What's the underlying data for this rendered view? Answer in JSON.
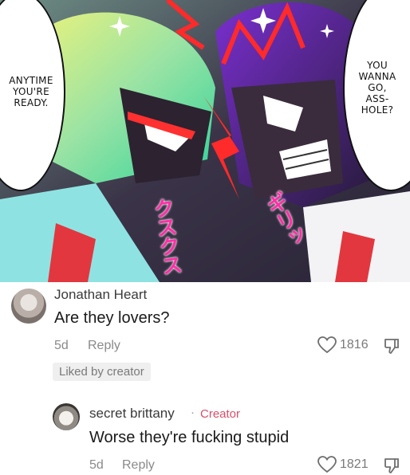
{
  "panel": {
    "bubble_left": "ANYTIME\nYOU'RE\nREADY.",
    "bubble_right": "YOU\nWANNA\nGO,\nASS-\nHOLE?",
    "sfx_left": "クスクス",
    "sfx_right": "ギリッ"
  },
  "comments": [
    {
      "author": "Jonathan Heart",
      "text": "Are they lovers?",
      "time": "5d",
      "reply_label": "Reply",
      "likes": "1816",
      "liked_by": "Liked by creator"
    },
    {
      "author": "secret brittany",
      "separator": "·",
      "badge": "Creator",
      "text": "Worse they're fucking stupid",
      "time": "5d",
      "reply_label": "Reply",
      "likes": "1821"
    }
  ],
  "colors": {
    "creator_badge": "#d94f6a",
    "sfx": "#ff2fa6"
  }
}
